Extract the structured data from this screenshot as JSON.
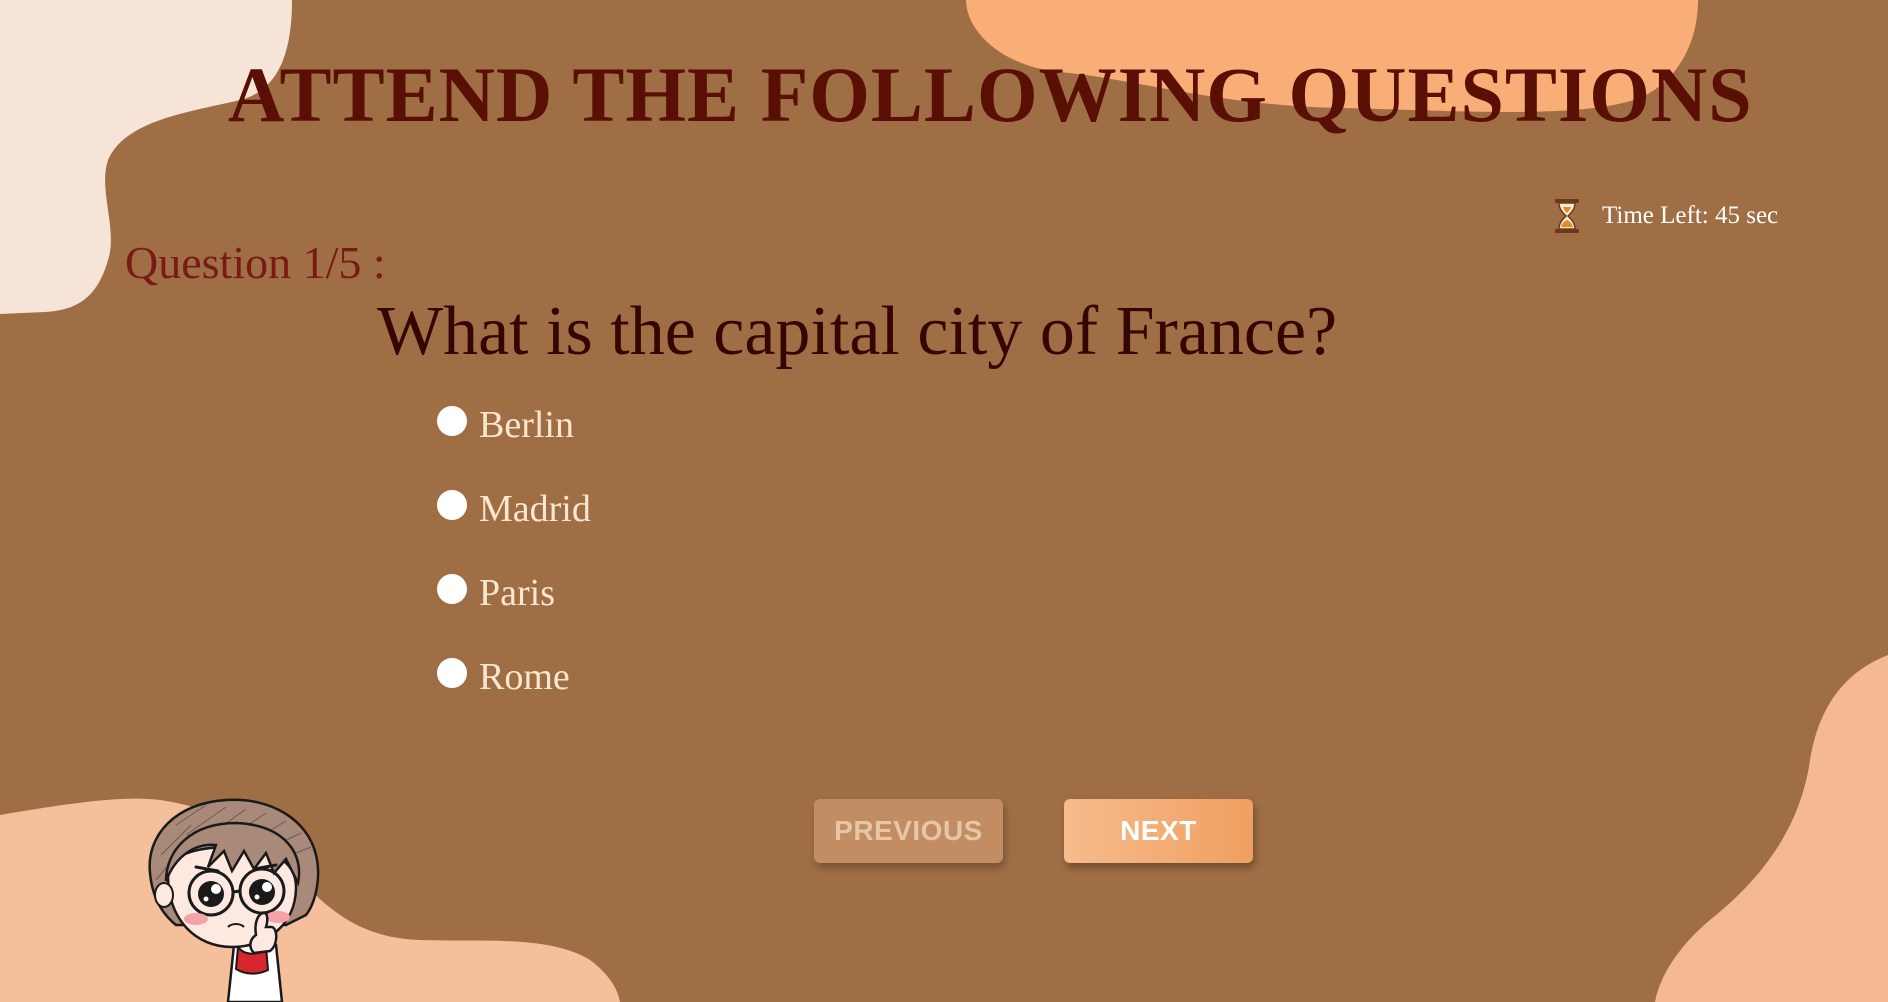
{
  "page": {
    "title": "ATTEND THE FOLLOWING QUESTIONS"
  },
  "timer": {
    "icon": "hourglass-icon",
    "label": "Time Left: 45 sec"
  },
  "question": {
    "counter": "Question 1/5 :",
    "text": "What is the capital city of France?",
    "options": [
      {
        "label": "Berlin",
        "selected": false
      },
      {
        "label": "Madrid",
        "selected": false
      },
      {
        "label": "Paris",
        "selected": false
      },
      {
        "label": "Rome",
        "selected": false
      }
    ]
  },
  "navigation": {
    "previous_label": "PREVIOUS",
    "previous_disabled": true,
    "next_label": "NEXT"
  },
  "colors": {
    "background": "#a06e45",
    "title": "#5a0f05",
    "counter": "#7a1a14",
    "question": "#340602",
    "option_text": "#fbe6cf",
    "accent": "#f7b47d",
    "blob_light": "#f7e4d8",
    "blob_peach": "#f5b98f"
  }
}
